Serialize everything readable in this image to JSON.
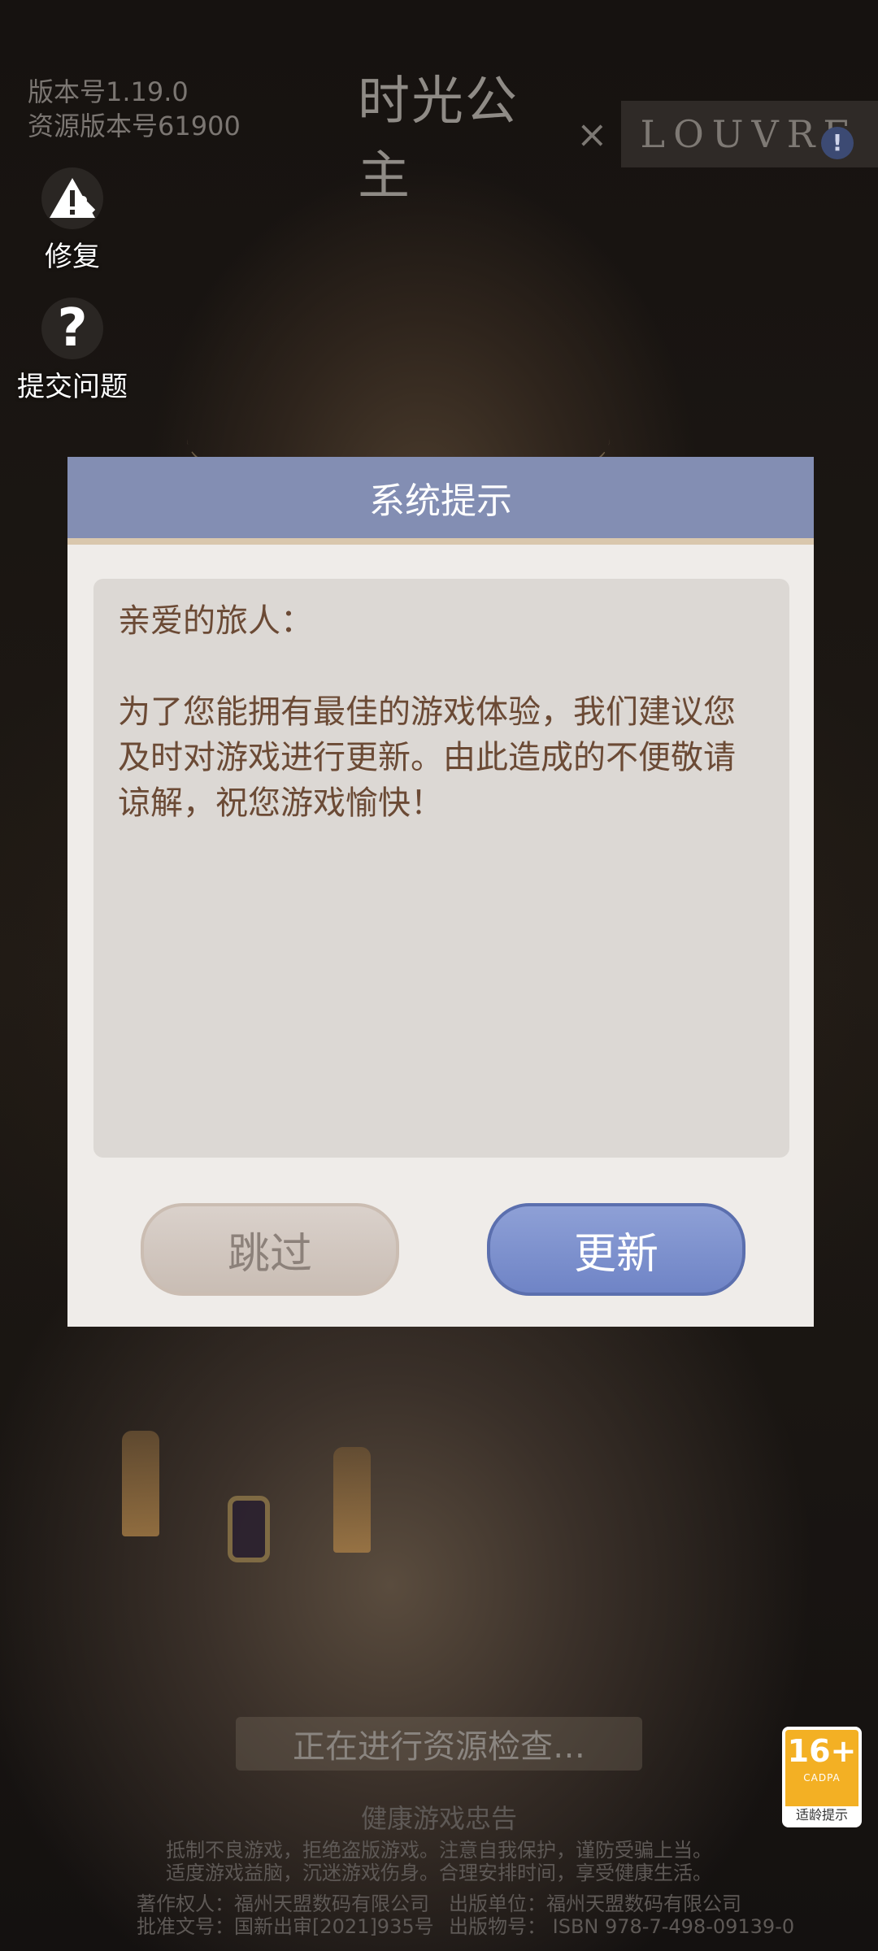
{
  "version": {
    "app_version": "版本号1.19.0",
    "resource_version": "资源版本号61900"
  },
  "logo": {
    "title": "时光公主",
    "cross": "×",
    "partner": "LOUVRE"
  },
  "side_buttons": [
    {
      "label": "修复",
      "icon": "warning-wrench-icon"
    },
    {
      "label": "提交问题",
      "icon": "question-icon"
    }
  ],
  "dialog": {
    "title": "系统提示",
    "greeting": "亲爱的旅人：",
    "message": "为了您能拥有最佳的游戏体验，我们建议您及时对游戏进行更新。由此造成的不便敬请谅解，祝您游戏愉快！",
    "skip_label": "跳过",
    "update_label": "更新"
  },
  "status": "正在进行资源检查…",
  "age_rating": {
    "rating": "16+",
    "org": "CADPA",
    "tip": "适龄提示"
  },
  "health_notice": {
    "title": "健康游戏忠告",
    "line1": "抵制不良游戏，拒绝盗版游戏。注意自我保护，谨防受骗上当。",
    "line2": "适度游戏益脑，沉迷游戏伤身。合理安排时间，享受健康生活。"
  },
  "credits": {
    "copyright": "著作权人：福州天盟数码有限公司",
    "approval": "批准文号：国新出审[2021]935号",
    "publisher": "出版单位：福州天盟数码有限公司",
    "isbn": "出版物号： ISBN 978-7-498-09139-0"
  },
  "colors": {
    "dialog_header": "#838eb3",
    "update_button": "#7a8ecc",
    "age_badge": "#f3b024"
  }
}
